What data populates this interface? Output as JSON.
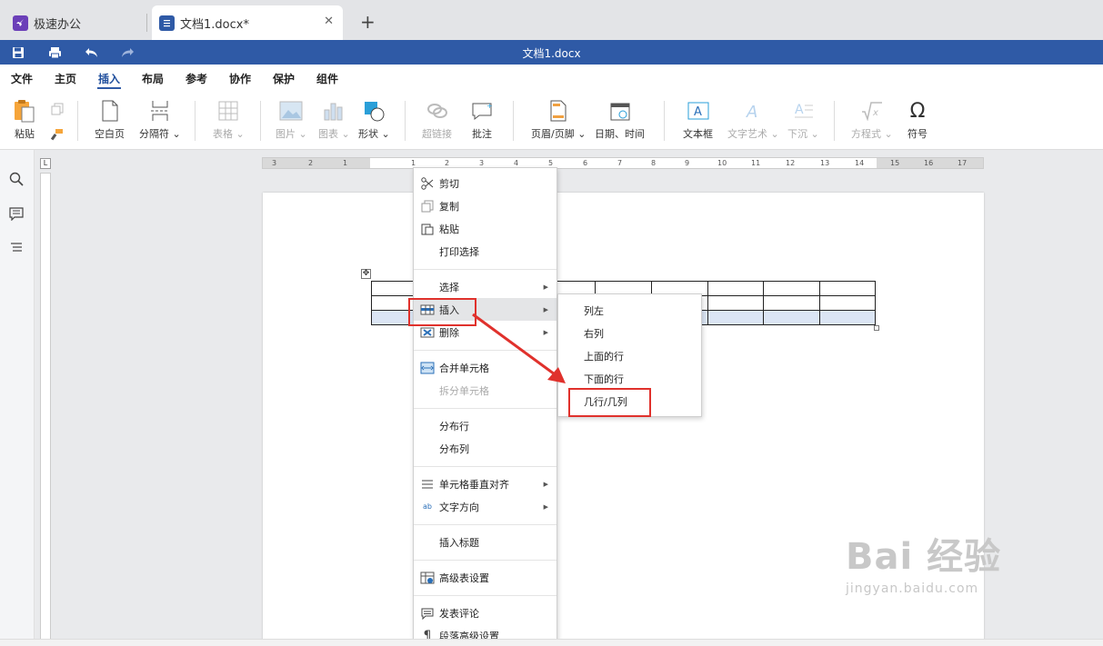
{
  "tabs": [
    {
      "label": "极速办公"
    },
    {
      "label": "文档1.docx*"
    }
  ],
  "window_title": "文档1.docx",
  "menu": [
    "文件",
    "主页",
    "插入",
    "布局",
    "参考",
    "协作",
    "保护",
    "组件"
  ],
  "active_menu": "插入",
  "ribbon": {
    "paste": "粘贴",
    "blank_page": "空白页",
    "separator": "分隔符",
    "table": "表格",
    "picture": "图片",
    "chart": "图表",
    "shape": "形状",
    "hyperlink": "超链接",
    "comment": "批注",
    "header_footer": "页眉/页脚",
    "date_time": "日期、时间",
    "textbox": "文本框",
    "wordart": "文字艺术",
    "dropcap": "下沉",
    "equation": "方程式",
    "symbol": "符号"
  },
  "ruler": {
    "corner": "L",
    "numbers": [
      "3",
      "2",
      "1",
      "1",
      "2",
      "3",
      "4",
      "5",
      "6",
      "7",
      "8",
      "9",
      "10",
      "11",
      "12",
      "13",
      "14",
      "15",
      "16",
      "17"
    ]
  },
  "context_menu": {
    "cut": "剪切",
    "copy": "复制",
    "paste": "粘贴",
    "print_selection": "打印选择",
    "select": "选择",
    "insert": "插入",
    "delete": "删除",
    "merge_cells": "合并单元格",
    "split_cells": "拆分单元格",
    "distribute_rows": "分布行",
    "distribute_cols": "分布列",
    "cell_valign": "单元格垂直对齐",
    "text_direction": "文字方向",
    "insert_caption": "插入标题",
    "advanced_table": "高级表设置",
    "post_comment": "发表评论",
    "paragraph_advanced": "段落高级设置"
  },
  "submenu": {
    "col_left": "列左",
    "col_right": "右列",
    "row_above": "上面的行",
    "row_below": "下面的行",
    "rows_cols": "几行/几列"
  },
  "watermark": {
    "main": "Bai 经验",
    "sub": "jingyan.baidu.com"
  },
  "colors": {
    "title_bar": "#2f5aa6",
    "highlight": "#e0312c",
    "selection": "#dbe5f4"
  }
}
